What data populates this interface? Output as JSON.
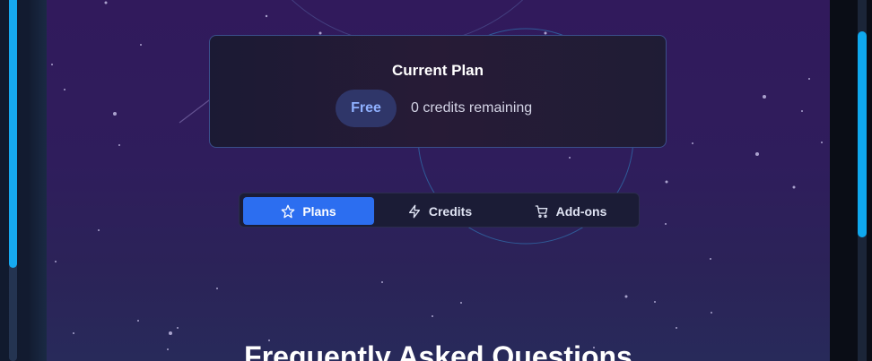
{
  "current_plan": {
    "title": "Current Plan",
    "plan_name": "Free",
    "credits_text": "0 credits remaining"
  },
  "tabs": [
    {
      "label": "Plans",
      "icon": "star-icon",
      "active": true
    },
    {
      "label": "Credits",
      "icon": "lightning-icon",
      "active": false
    },
    {
      "label": "Add-ons",
      "icon": "cart-icon",
      "active": false
    }
  ],
  "faq": {
    "title": "Frequently Asked Questions"
  },
  "colors": {
    "accent": "#2c6ef0",
    "scrollbar": "#16a9f0",
    "badge_text": "#8fb0ff",
    "background_top": "#311a5c"
  }
}
